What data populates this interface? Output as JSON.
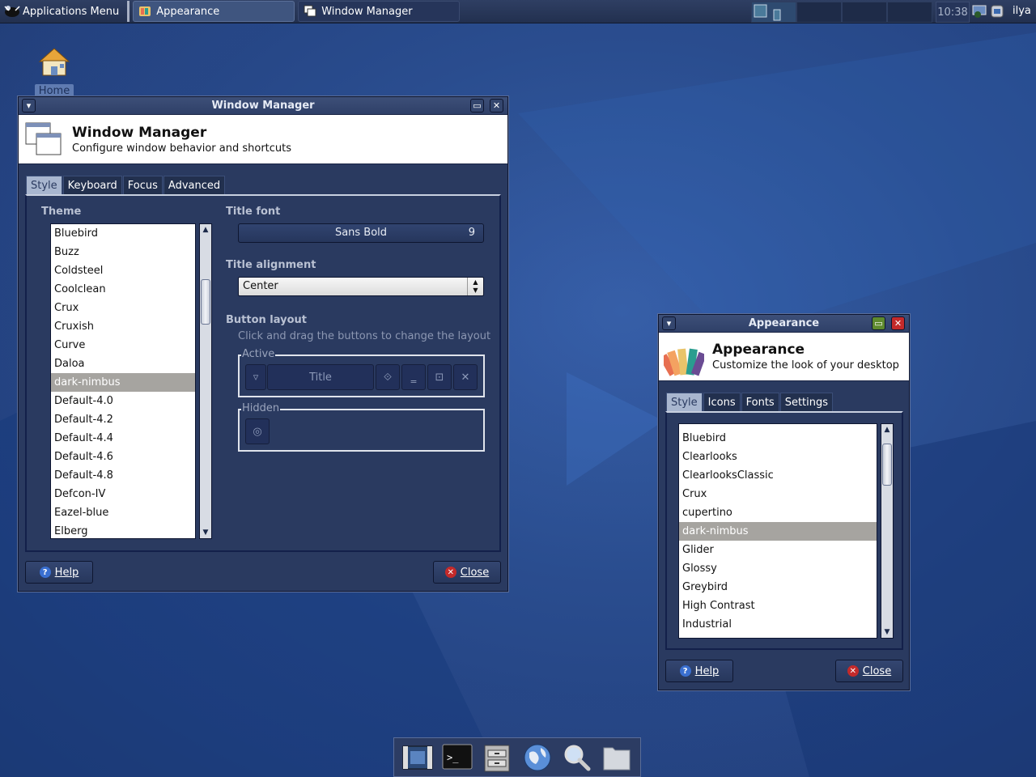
{
  "top_panel": {
    "apps_menu_label": "Applications Menu",
    "tasks": [
      {
        "label": "Appearance",
        "active": true
      },
      {
        "label": "Window Manager",
        "active": false
      }
    ],
    "clock": "10:38",
    "user": "ilya"
  },
  "desktop": {
    "home_label": "Home"
  },
  "wm": {
    "title": "Window Manager",
    "header_title": "Window Manager",
    "header_subtitle": "Configure window behavior and shortcuts",
    "tabs": [
      "Style",
      "Keyboard",
      "Focus",
      "Advanced"
    ],
    "theme_label": "Theme",
    "themes": [
      "Bluebird",
      "Buzz",
      "Coldsteel",
      "Coolclean",
      "Crux",
      "Cruxish",
      "Curve",
      "Daloa",
      "dark-nimbus",
      "Default-4.0",
      "Default-4.2",
      "Default-4.4",
      "Default-4.6",
      "Default-4.8",
      "Defcon-IV",
      "Eazel-blue",
      "Elberg"
    ],
    "selected_theme": "dark-nimbus",
    "title_font_label": "Title font",
    "title_font_name": "Sans Bold",
    "title_font_size": "9",
    "title_alignment_label": "Title alignment",
    "title_alignment_value": "Center",
    "button_layout_label": "Button layout",
    "button_layout_hint": "Click and drag the buttons to change the layout",
    "active_label": "Active",
    "active_title_label": "Title",
    "hidden_label": "Hidden",
    "help_label": "Help",
    "close_label": "Close"
  },
  "appearance": {
    "title": "Appearance",
    "header_title": "Appearance",
    "header_subtitle": "Customize the look of your desktop",
    "tabs": [
      "Style",
      "Icons",
      "Fonts",
      "Settings"
    ],
    "themes": [
      "Bluebird",
      "Clearlooks",
      "ClearlooksClassic",
      "Crux",
      "cupertino",
      "dark-nimbus",
      "Glider",
      "Glossy",
      "Greybird",
      "High Contrast",
      "Industrial"
    ],
    "selected_theme": "dark-nimbus",
    "help_label": "Help",
    "close_label": "Close"
  },
  "dock": {
    "items": [
      "video-player-icon",
      "terminal-icon",
      "file-manager-icon",
      "web-browser-icon",
      "search-icon",
      "folder-icon"
    ]
  },
  "colors": {
    "selection": "#a6a4a0",
    "panel": "#2f3f63",
    "desktop": "#1d4288"
  }
}
